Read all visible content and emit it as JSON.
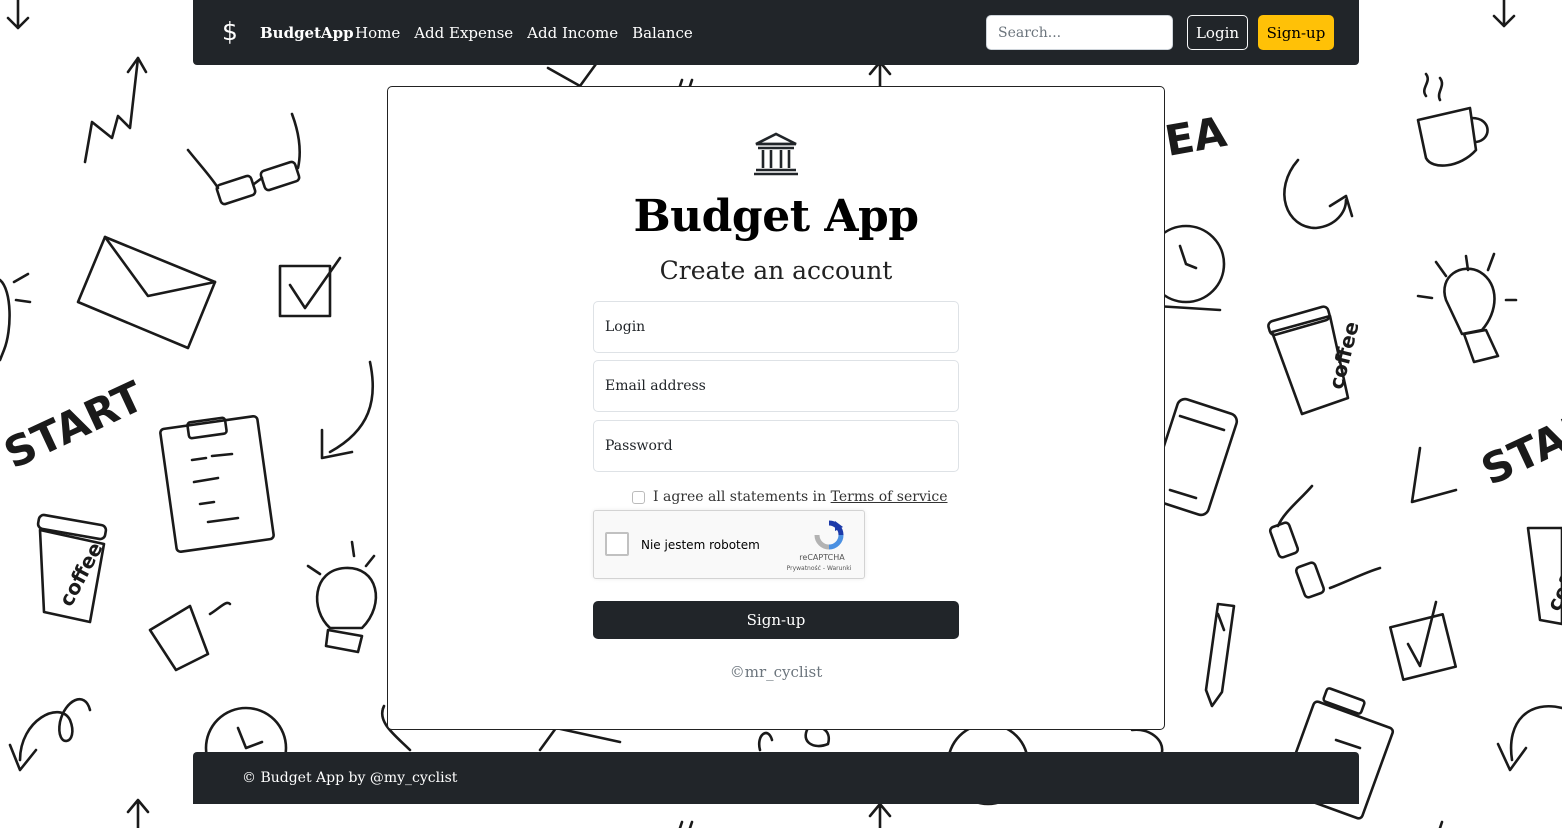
{
  "navbar": {
    "brand_icon": "$",
    "brand": "BudgetApp",
    "links": [
      "Home",
      "Add Expense",
      "Add Income",
      "Balance"
    ],
    "search_placeholder": "Search...",
    "login_label": "Login",
    "signup_label": "Sign-up",
    "signup_color": "#ffc107",
    "background": "#212529"
  },
  "form": {
    "icon": "bank-icon",
    "title": "Budget App",
    "subtitle": "Create an account",
    "login_placeholder": "Login",
    "email_placeholder": "Email address",
    "password_placeholder": "Password",
    "agree_text": "I agree all statements in",
    "terms_link": "Terms of service",
    "captcha": {
      "label": "Nie jestem robotem",
      "brand": "reCAPTCHA",
      "terms": "Prywatność - Warunki"
    },
    "submit_label": "Sign-up",
    "copyright": "©mr_cyclist"
  },
  "footer": {
    "text": "© Budget App by @my_cyclist"
  }
}
